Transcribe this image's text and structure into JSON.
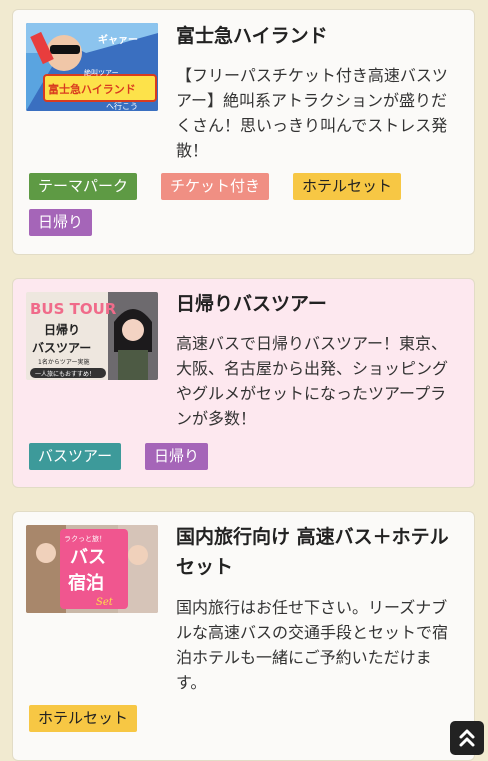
{
  "items": [
    {
      "title": "富士急ハイランド",
      "description": "【フリーパスチケット付き高速バスツアー】絶叫系アトラクションが盛りだくさん！思いっきり叫んでストレス発散！",
      "thumb_text": [
        "絶叫ツアー",
        "富士急ハイランド",
        "へ行こう",
        "ギャァー"
      ],
      "tags": [
        "テーマパーク",
        "チケット付き",
        "ホテルセット",
        "日帰り"
      ]
    },
    {
      "title": "日帰りバスツアー",
      "description": "高速バスで日帰りバスツアー！東京、大阪、名古屋から出発、ショッピングやグルメがセットになったツアープランが多数！",
      "thumb_text": [
        "BUS TOUR",
        "日帰り",
        "バスツアー",
        "1名からツアー実施",
        "一人旅にもおすすめ！"
      ],
      "tags": [
        "バスツアー",
        "日帰り"
      ]
    },
    {
      "title": "国内旅行向け 高速バス＋ホテルセット",
      "description": "国内旅行はお任せ下さい。リーズナブルな高速バスの交通手段とセットで宿泊ホテルも一緒にご予約いただけます。",
      "thumb_text": [
        "ラクっと旅！",
        "バス",
        "宿泊",
        "Set"
      ],
      "tags": [
        "ホテルセット"
      ]
    }
  ],
  "colors": {
    "background": "#f1ead0",
    "tag_theme_park": "#5e9a44",
    "tag_ticket": "#f08f83",
    "tag_hotel": "#f7c744",
    "tag_day_trip": "#a565b8",
    "tag_bus_tour": "#3d9a9a"
  },
  "icons": {
    "scroll_top": "double-chevron-up-icon"
  }
}
